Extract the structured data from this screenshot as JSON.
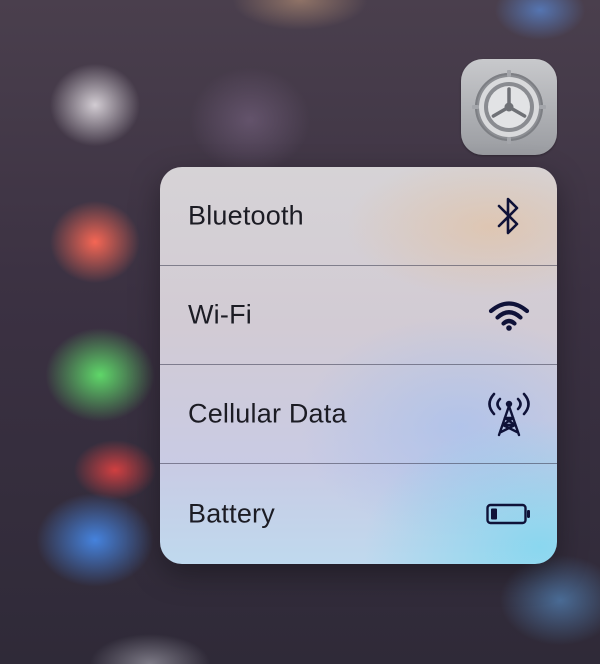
{
  "menu": {
    "items": [
      {
        "label": "Bluetooth",
        "icon": "bluetooth-icon"
      },
      {
        "label": "Wi-Fi",
        "icon": "wifi-icon"
      },
      {
        "label": "Cellular Data",
        "icon": "cellular-antenna-icon"
      },
      {
        "label": "Battery",
        "icon": "battery-icon"
      }
    ]
  },
  "app_icon": {
    "name": "settings-gear-icon"
  },
  "colors": {
    "icon_stroke": "#0f1238",
    "label_text": "#1c1c24",
    "settings_icon_gray": "#9a9ca1"
  }
}
